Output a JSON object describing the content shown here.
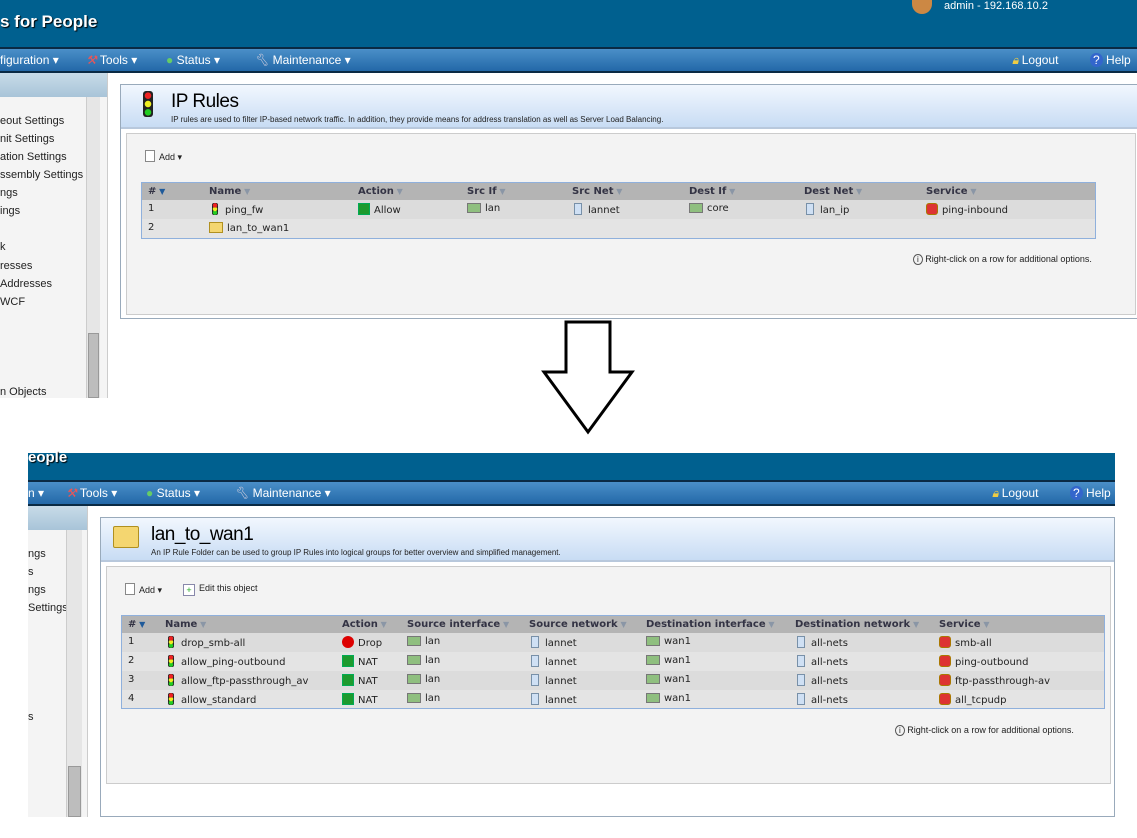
{
  "top": {
    "brand": "s for People",
    "user": "admin - 192.168.10.2",
    "nav": [
      "figuration",
      "Tools",
      "Status",
      "Maintenance"
    ],
    "logout": "Logout",
    "help": "Help",
    "sidebar": [
      "eout Settings",
      "nit Settings",
      "ation Settings",
      "ssembly Settings",
      "ngs",
      "ings",
      "k",
      "resses",
      "Addresses",
      "WCF",
      "n Objects"
    ],
    "title": "IP Rules",
    "desc": "IP rules are used to filter IP-based network traffic. In addition, they provide means for address translation as well as Server Load Balancing.",
    "add": "Add",
    "columns": [
      "#",
      "Name",
      "Action",
      "Src If",
      "Src Net",
      "Dest If",
      "Dest Net",
      "Service"
    ],
    "rows": [
      {
        "n": "1",
        "name": "ping_fw",
        "type": "rule",
        "action": "Allow",
        "src_if": "lan",
        "src_net": "lannet",
        "dest_if": "core",
        "dest_net": "lan_ip",
        "service": "ping-inbound"
      },
      {
        "n": "2",
        "name": "lan_to_wan1",
        "type": "folder",
        "action": "",
        "src_if": "",
        "src_net": "",
        "dest_if": "",
        "dest_net": "",
        "service": ""
      }
    ],
    "hint": "Right-click on a row for additional options."
  },
  "bottom": {
    "brand": "eople",
    "nav": [
      "n",
      "Tools",
      "Status",
      "Maintenance"
    ],
    "logout": "Logout",
    "help": "Help",
    "sidebar": [
      "ngs",
      "s",
      "ngs",
      "Settings",
      "s"
    ],
    "title": "lan_to_wan1",
    "desc": "An IP Rule Folder can be used to group IP Rules into logical groups for better overview and simplified management.",
    "add": "Add",
    "edit": "Edit this object",
    "columns": [
      "#",
      "Name",
      "Action",
      "Source interface",
      "Source network",
      "Destination interface",
      "Destination network",
      "Service"
    ],
    "rows": [
      {
        "n": "1",
        "name": "drop_smb-all",
        "type": "rule",
        "action": "Drop",
        "src_if": "lan",
        "src_net": "lannet",
        "dest_if": "wan1",
        "dest_net": "all-nets",
        "service": "smb-all"
      },
      {
        "n": "2",
        "name": "allow_ping-outbound",
        "type": "rule",
        "action": "NAT",
        "src_if": "lan",
        "src_net": "lannet",
        "dest_if": "wan1",
        "dest_net": "all-nets",
        "service": "ping-outbound"
      },
      {
        "n": "3",
        "name": "allow_ftp-passthrough_av",
        "type": "rule",
        "action": "NAT",
        "src_if": "lan",
        "src_net": "lannet",
        "dest_if": "wan1",
        "dest_net": "all-nets",
        "service": "ftp-passthrough-av"
      },
      {
        "n": "4",
        "name": "allow_standard",
        "type": "rule",
        "action": "NAT",
        "src_if": "lan",
        "src_net": "lannet",
        "dest_if": "wan1",
        "dest_net": "all-nets",
        "service": "all_tcpudp"
      }
    ],
    "hint": "Right-click on a row for additional options."
  }
}
